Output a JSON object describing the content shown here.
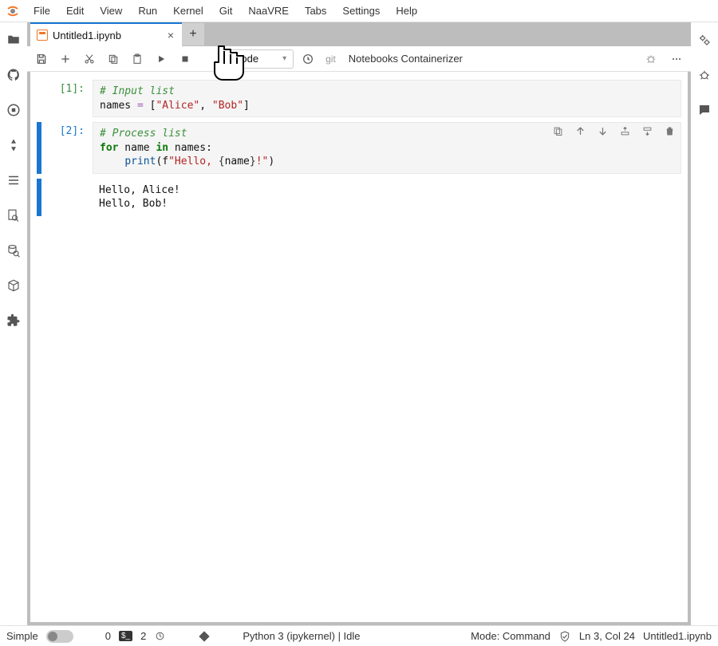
{
  "menu": {
    "items": [
      "File",
      "Edit",
      "View",
      "Run",
      "Kernel",
      "Git",
      "NaaVRE",
      "Tabs",
      "Settings",
      "Help"
    ]
  },
  "tab": {
    "title": "Untitled1.ipynb"
  },
  "toolbar": {
    "celltype": "Code",
    "git": "git",
    "containerizer": "Notebooks Containerizer"
  },
  "cells": [
    {
      "prompt": "[1]:",
      "code_html": "<span class='c-comment'># Input list</span>\nnames <span class='c-op'>=</span> [<span class='c-str'>\"Alice\"</span>, <span class='c-str'>\"Bob\"</span>]"
    },
    {
      "prompt": "[2]:",
      "code_html": "<span class='c-comment'># Process list</span>\n<span class='c-kw'>for</span> name <span class='c-kw'>in</span> names:\n    <span class='c-fn'>print</span>(<span class='c-name'>f</span><span class='c-str'>\"Hello, </span><span class='c-brace'>{</span>name<span class='c-brace'>}</span><span class='c-str'>!\"</span>)",
      "output": "Hello, Alice!\nHello, Bob!"
    }
  ],
  "status": {
    "simple": "Simple",
    "zero": "0",
    "terminals": "2",
    "kernel": "Python 3 (ipykernel) | Idle",
    "mode": "Mode: Command",
    "cursor": "Ln 3, Col 24",
    "file": "Untitled1.ipynb"
  },
  "icons": {
    "jupyter": "jupyter-icon",
    "plus": "+",
    "close": "×"
  }
}
